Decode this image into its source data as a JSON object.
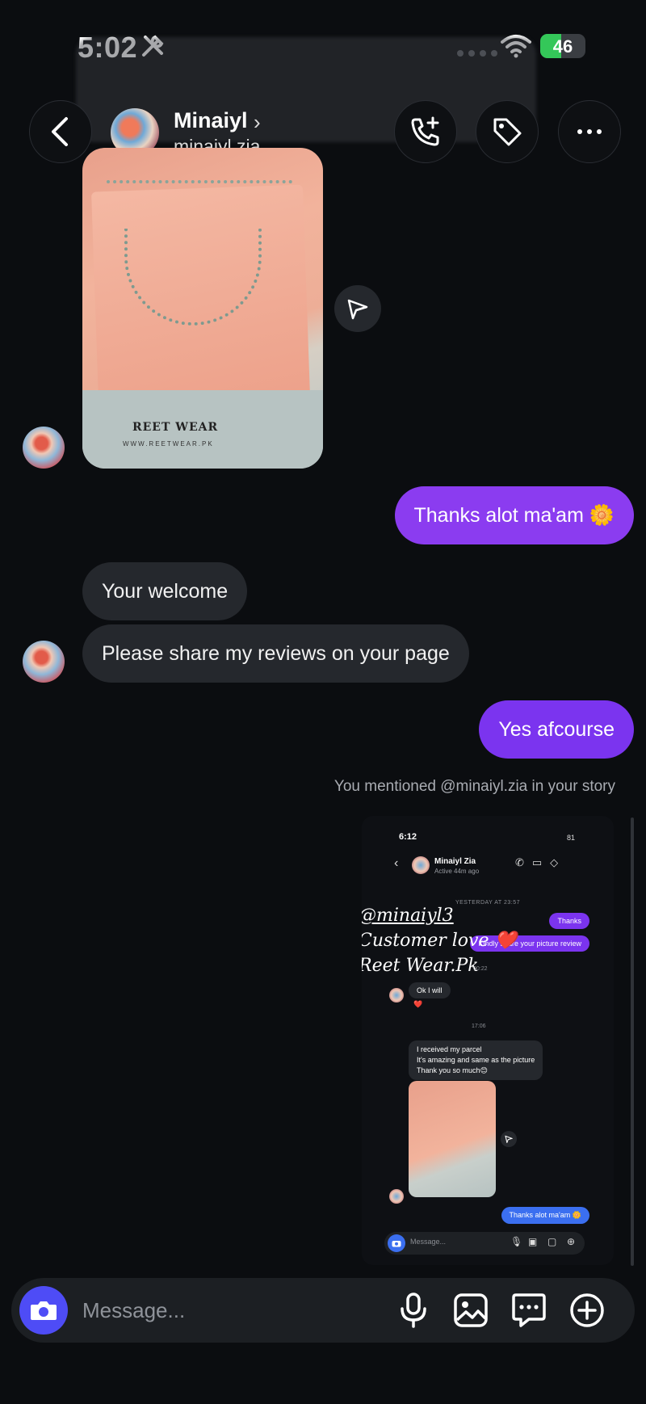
{
  "status_bar": {
    "time": "5:02",
    "battery": "46",
    "battery_level": 0.46
  },
  "header": {
    "name": "Minaiyl",
    "username": "minaiyl.zia"
  },
  "photo_message": {
    "brand_text": "REET WEAR",
    "site_text": "WWW.REETWEAR.PK"
  },
  "messages": [
    {
      "side": "out",
      "text": "Thanks alot ma'am 🌼"
    },
    {
      "side": "in",
      "text": "Your welcome"
    },
    {
      "side": "in",
      "text": "Please share my reviews on your page"
    },
    {
      "side": "out",
      "text": "Yes afcourse"
    }
  ],
  "mention_note": "You mentioned @minaiyl.zia in your story",
  "story": {
    "time": "6:12",
    "battery": "81",
    "name": "Minaiyl Zia",
    "active": "Active 44m ago",
    "day_label": "YESTERDAY AT 23:57",
    "overlay_lines": [
      "@minaiyl3",
      "Customer love ❤️",
      "Reet Wear.Pk"
    ],
    "bubble_thanks": "Thanks",
    "bubble_share": "Kindly share your picture review",
    "time_mark_1": "00:22",
    "bubble_ok": "Ok I will",
    "reaction": "❤️",
    "time_mark_2": "17:06",
    "bubble_parcel_1": "I received my parcel",
    "bubble_parcel_2": "It's amazing and same as the picture",
    "bubble_parcel_3": "Thank you so much😊",
    "bubble_thanks_maam": "Thanks alot ma'am 🌼",
    "composer_placeholder": "Message..."
  },
  "composer": {
    "placeholder": "Message..."
  },
  "colors": {
    "outgoing": "#8b3cf0",
    "incoming": "#25282d",
    "camera": "#4e4cf6",
    "background": "#0b0d10"
  }
}
